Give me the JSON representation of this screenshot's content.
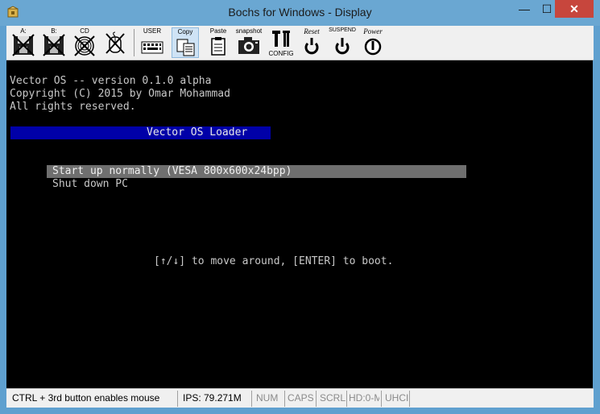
{
  "window": {
    "title": "Bochs for Windows - Display",
    "min_glyph": "—",
    "max_glyph": "☐",
    "close_glyph": "✕"
  },
  "toolbar": {
    "floppy_a": "A:",
    "floppy_b": "B:",
    "cdrom": "CD",
    "mouse": "",
    "user": "USER",
    "copy": "Copy",
    "paste": "Paste",
    "snapshot": "snapshot",
    "config": "CONFIG",
    "reset": "Reset",
    "suspend": "SUSPEND",
    "power": "Power"
  },
  "screen": {
    "line1": "Vector OS -- version 0.1.0 alpha",
    "line2": "Copyright (C) 2015 by Omar Mohammad",
    "line3": "All rights reserved.",
    "loader_title": "Vector OS Loader",
    "menu": [
      "Start up normally (VESA 800x600x24bpp)",
      "Shut down PC"
    ],
    "hint": "[↑/↓] to move around, [ENTER] to boot."
  },
  "statusbar": {
    "message": "CTRL + 3rd button enables mouse",
    "ips": "IPS: 79.271M",
    "num": "NUM",
    "caps": "CAPS",
    "scrl": "SCRL",
    "hd": "HD:0-M",
    "uhci": "UHCI"
  }
}
